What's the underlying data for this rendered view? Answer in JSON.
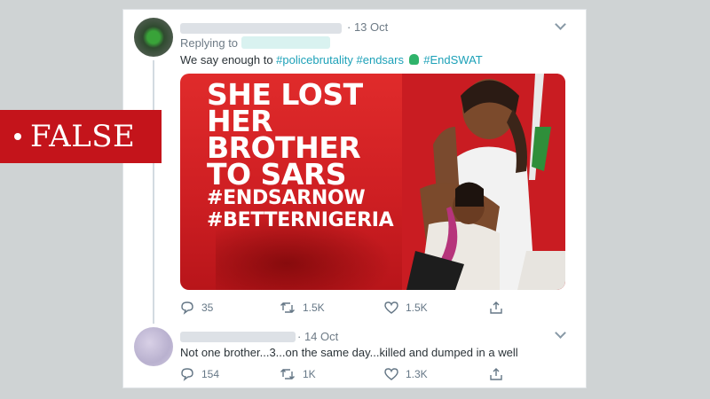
{
  "tweet1": {
    "date": "· 13 Oct",
    "replying_label": "Replying to",
    "text_prefix": "We say enough to ",
    "hashtags": [
      "#policebrutality",
      "#endsars",
      "#EndSWAT"
    ],
    "media": {
      "headline": [
        "SHE LOST",
        "HER",
        "BROTHER",
        "TO SARS"
      ],
      "tags": [
        "#ENDSARNOW",
        "#BETTERNIGERIA"
      ]
    },
    "actions": {
      "replies": "35",
      "retweets": "1.5K",
      "likes": "1.5K"
    }
  },
  "tweet2": {
    "date": "· 14 Oct",
    "text": "Not one brother...3...on the same day...killed and dumped in a well",
    "actions": {
      "replies": "154",
      "retweets": "1K",
      "likes": "1.3K"
    }
  },
  "banner": {
    "label": "FALSE"
  },
  "colors": {
    "banner": "#c4141b",
    "link": "#1da1b8",
    "media_bg": "#d62428"
  }
}
